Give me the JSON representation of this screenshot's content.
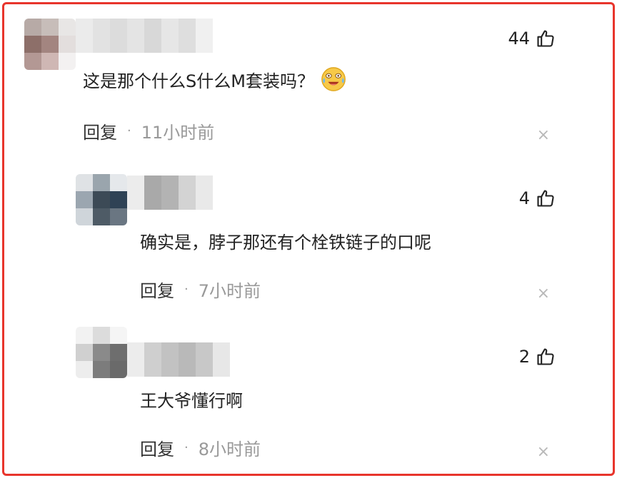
{
  "comments": [
    {
      "likes": "44",
      "text": "这是那个什么S什么M套装吗？",
      "emoji": "laughing-crying-emoji",
      "reply_label": "回复",
      "time": "11小时前"
    },
    {
      "likes": "4",
      "text": "确实是，脖子那还有个栓铁链子的口呢",
      "reply_label": "回复",
      "time": "7小时前"
    },
    {
      "likes": "2",
      "text": "王大爷懂行啊",
      "reply_label": "回复",
      "time": "8小时前"
    }
  ],
  "separator": "·",
  "close_glyph": "×",
  "colors": {
    "frame_border": "#e8352c",
    "text": "#222222",
    "meta": "#999999",
    "close": "#b8b8b8"
  }
}
